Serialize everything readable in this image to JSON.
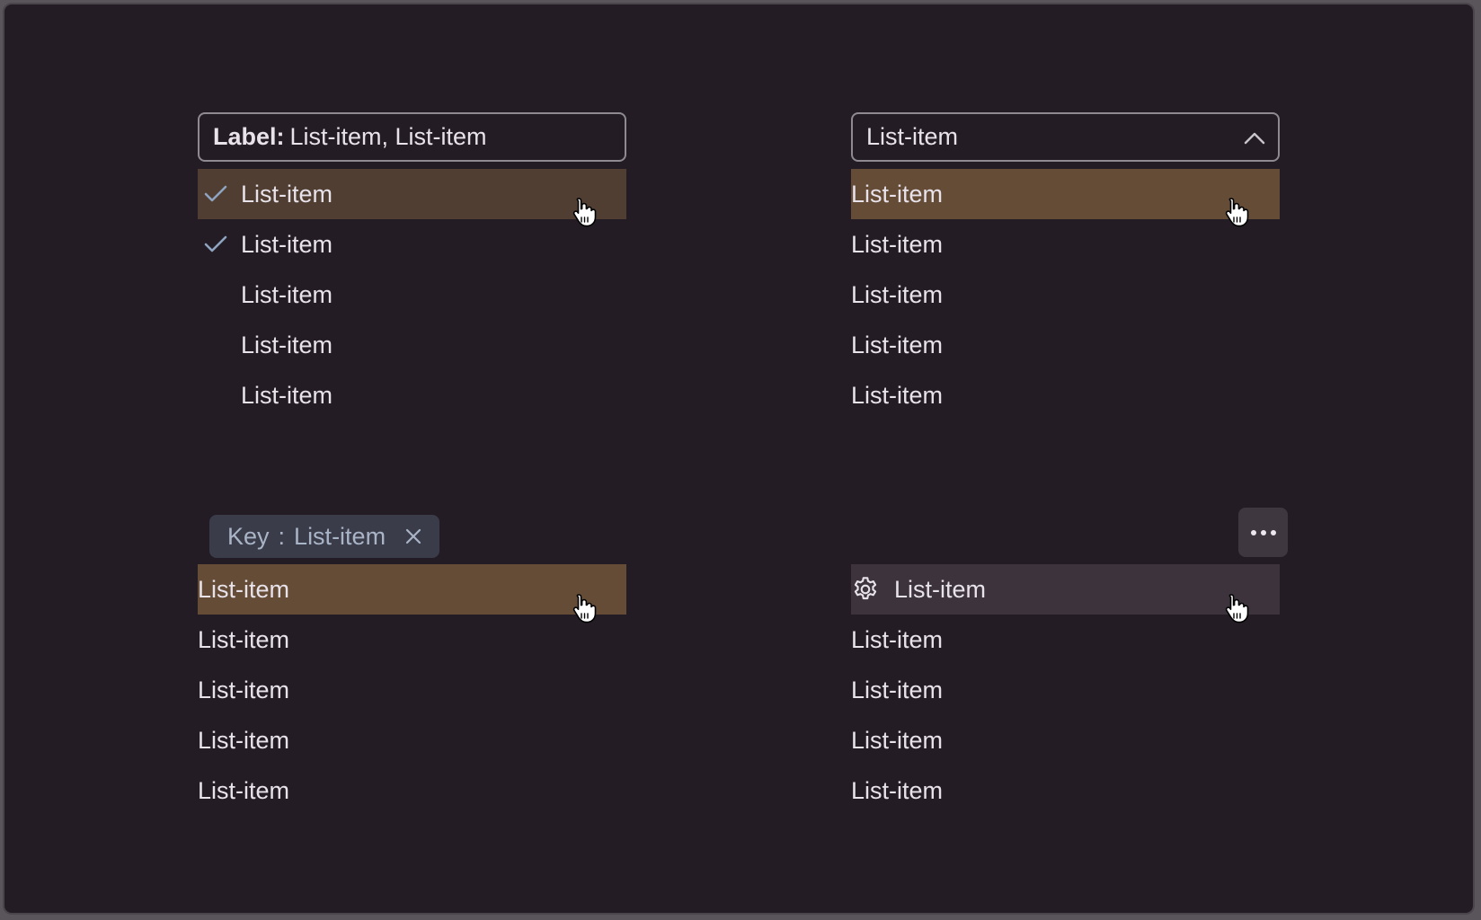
{
  "multiselect": {
    "label": "Label:",
    "value": "List-item, List-item",
    "items": [
      {
        "label": "List-item",
        "checked": true
      },
      {
        "label": "List-item",
        "checked": true
      },
      {
        "label": "List-item",
        "checked": false
      },
      {
        "label": "List-item",
        "checked": false
      },
      {
        "label": "List-item",
        "checked": false
      }
    ]
  },
  "select": {
    "value": "List-item",
    "items": [
      "List-item",
      "List-item",
      "List-item",
      "List-item",
      "List-item"
    ]
  },
  "filter": {
    "chip": {
      "key": "Key",
      "separator": ":",
      "value": "List-item"
    },
    "items": [
      "List-item",
      "List-item",
      "List-item",
      "List-item",
      "List-item"
    ]
  },
  "menu": {
    "items": [
      {
        "label": "List-item",
        "icon": "gear-icon"
      },
      {
        "label": "List-item"
      },
      {
        "label": "List-item"
      },
      {
        "label": "List-item"
      },
      {
        "label": "List-item"
      }
    ]
  },
  "colors": {
    "background": "#241c25",
    "hover_brown": "#654c36",
    "hover_brown_dark": "#4f3e31",
    "hover_gray": "#3c333d",
    "check": "#8fa4c0"
  }
}
